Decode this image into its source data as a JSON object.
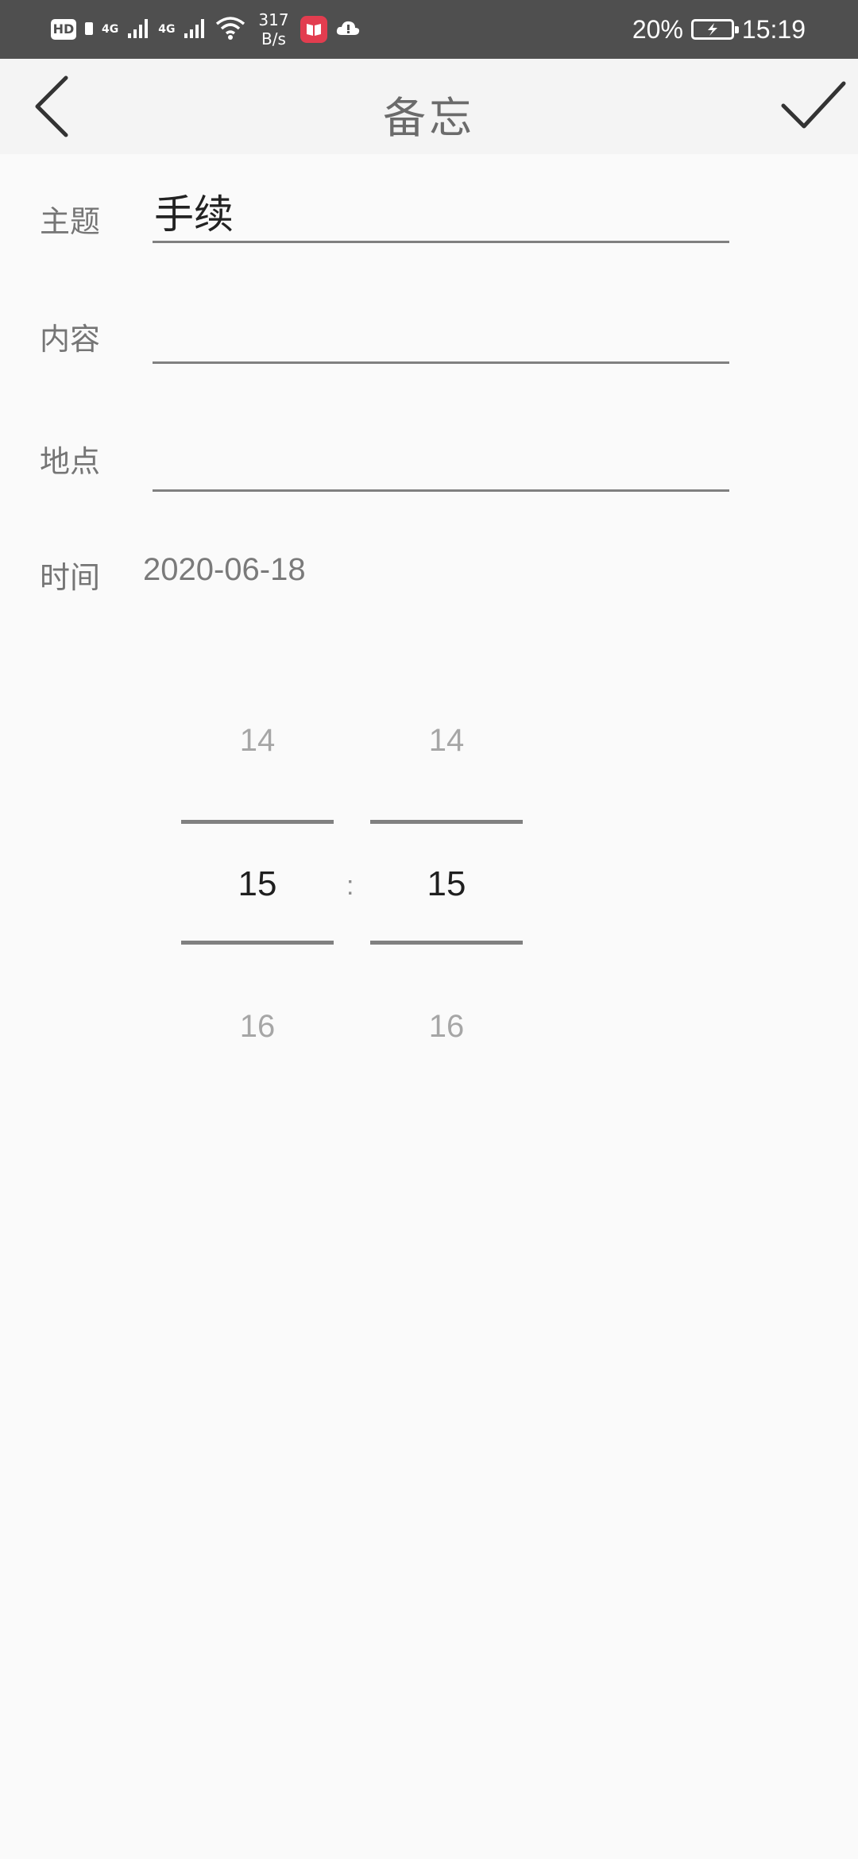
{
  "status_bar": {
    "hd": "HD",
    "signal1": "4G",
    "signal2": "4G",
    "net_speed_value": "317",
    "net_speed_unit": "B/s",
    "battery": "20%",
    "time": "15:19"
  },
  "header": {
    "title": "备忘"
  },
  "form": {
    "subject_label": "主题",
    "subject_value": "手续",
    "content_label": "内容",
    "content_value": "",
    "location_label": "地点",
    "location_value": "",
    "time_label": "时间",
    "date_value": "2020-06-18"
  },
  "time_picker": {
    "hour": {
      "prev": "14",
      "selected": "15",
      "next": "16"
    },
    "minute": {
      "prev": "14",
      "selected": "15",
      "next": "16"
    },
    "separator": ":"
  }
}
